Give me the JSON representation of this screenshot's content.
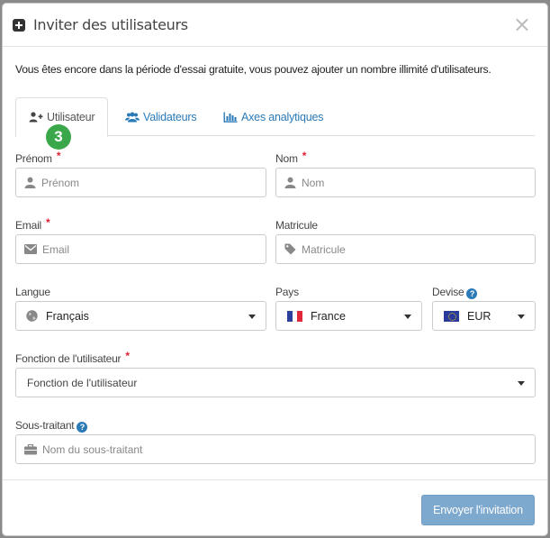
{
  "modal": {
    "title": "Inviter des utilisateurs",
    "close_label": "×",
    "intro": "Vous êtes encore dans la période d'essai gratuite, vous pouvez ajouter un nombre illimité d'utilisateurs."
  },
  "tabs": [
    {
      "label": "Utilisateur",
      "icon": "user-plus-icon",
      "active": true
    },
    {
      "label": "Validateurs",
      "icon": "users-icon",
      "active": false
    },
    {
      "label": "Axes analytiques",
      "icon": "bar-chart-icon",
      "active": false
    }
  ],
  "badge": "3",
  "form": {
    "prenom": {
      "label": "Prénom",
      "required": "*",
      "placeholder": "Prénom",
      "icon": "user-icon"
    },
    "nom": {
      "label": "Nom",
      "required": "*",
      "placeholder": "Nom",
      "icon": "user-icon"
    },
    "email": {
      "label": "Email",
      "required": "*",
      "placeholder": "Email",
      "icon": "envelope-icon"
    },
    "matricule": {
      "label": "Matricule",
      "placeholder": "Matricule",
      "icon": "tag-icon"
    },
    "langue": {
      "label": "Langue",
      "value": "Français",
      "icon": "globe-icon"
    },
    "pays": {
      "label": "Pays",
      "value": "France",
      "icon": "flag-fr-icon"
    },
    "devise": {
      "label": "Devise",
      "value": "EUR",
      "icon": "flag-eu-icon"
    },
    "fonction": {
      "label": "Fonction de l'utilisateur",
      "required": "*",
      "value": "Fonction de l'utilisateur"
    },
    "sous_traitant": {
      "label": "Sous-traitant",
      "placeholder": "Nom du sous-traitant",
      "icon": "briefcase-icon"
    },
    "help_glyph": "?"
  },
  "footer": {
    "submit_label": "Envoyer l'invitation"
  },
  "colors": {
    "accent": "#2a7ab8",
    "required": "#d23",
    "button": "#7ea9cf",
    "badge": "#3aa84a"
  }
}
